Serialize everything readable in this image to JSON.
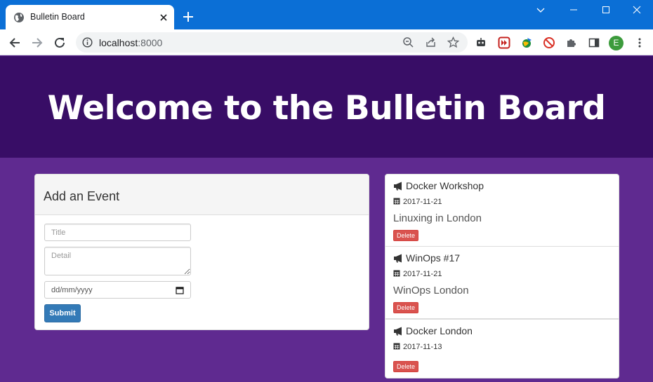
{
  "browser": {
    "tab_title": "Bulletin Board",
    "url_host": "localhost",
    "url_port": ":8000",
    "avatar_letter": "E",
    "accent_color": "#0b6fd6"
  },
  "page": {
    "heading": "Welcome to the Bulletin Board",
    "header_color": "#380d66",
    "body_color": "#5f2a90"
  },
  "form": {
    "title": "Add an Event",
    "title_placeholder": "Title",
    "detail_placeholder": "Detail",
    "date_placeholder": "dd/mm/yyyy",
    "submit_label": "Submit"
  },
  "events": [
    {
      "title": "Docker Workshop",
      "date": "2017-11-21",
      "detail": "Linuxing in London",
      "delete_label": "Delete"
    },
    {
      "title": "WinOps #17",
      "date": "2017-11-21",
      "detail": "WinOps London",
      "delete_label": "Delete"
    },
    {
      "title": "Docker London",
      "date": "2017-11-13",
      "detail": "",
      "delete_label": "Delete"
    }
  ]
}
